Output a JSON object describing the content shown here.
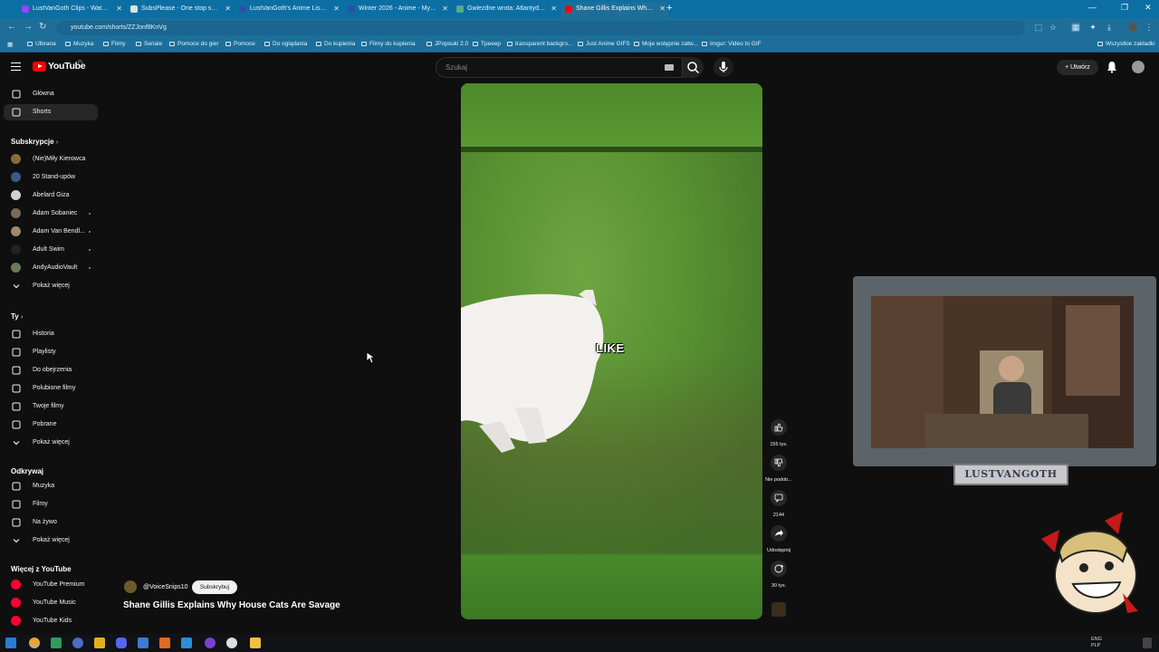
{
  "browser": {
    "tabs": [
      {
        "title": "LustVanGoth Clips - Watch Live",
        "color": "#9146ff"
      },
      {
        "title": "SubsPlease - One stop shop fo",
        "color": "#e0e0e0"
      },
      {
        "title": "LustVanGoth's Anime List - My",
        "color": "#2e51a2"
      },
      {
        "title": "Winter 2026 - Anime - MyAnim",
        "color": "#2e51a2"
      },
      {
        "title": "Gwiezdne wrota: Atlantyda / Sta",
        "color": "#55aa88"
      },
      {
        "title": "Shane Gillis Explains Why H",
        "color": "#ff0000"
      }
    ],
    "url": "youtube.com/shorts/ZZJonf8KnVg",
    "bookmarks": [
      "Ulbrana",
      "Muzyka",
      "Filmy",
      "Seriale",
      "Pomoce do gier",
      "Pomoce",
      "Do oglądania",
      "Do kupienia",
      "Filmy do kupienia",
      "JPopsuki 2.0",
      "Tpeeep",
      "transparent backgro...",
      "Just Anime GIFS",
      "Moje wstępnie zatw...",
      "Imgur: Video to GIF"
    ],
    "all_bookmarks": "Wszystkie zakładki"
  },
  "youtube": {
    "logo_text": "YouTube",
    "logo_country": "PL",
    "search_placeholder": "Szukaj",
    "create_label": "Utwórz"
  },
  "sidebar": {
    "main": [
      {
        "label": "Główna",
        "icon": "home-icon"
      },
      {
        "label": "Shorts",
        "icon": "shorts-icon"
      }
    ],
    "subs_header": "Subskrypcje",
    "subs": [
      {
        "label": "(Nie)Miły Kierowca",
        "color": "#8a6a3a",
        "dot": false
      },
      {
        "label": "20 Stand-upów",
        "color": "#3a5a8a",
        "dot": false
      },
      {
        "label": "Abelard Giza",
        "color": "#d0d0d0",
        "dot": false
      },
      {
        "label": "Adam Sobaniec",
        "color": "#7a6a5a",
        "dot": true
      },
      {
        "label": "Adam Van Bendl...",
        "color": "#a08a6a",
        "dot": true
      },
      {
        "label": "Adult Swim",
        "color": "#222222",
        "dot": true
      },
      {
        "label": "AndyAudioVault",
        "color": "#6a7a5a",
        "dot": true
      }
    ],
    "show_more": "Pokaż więcej",
    "you_header": "Ty",
    "you": [
      {
        "label": "Historia",
        "icon": "history-icon"
      },
      {
        "label": "Playlisty",
        "icon": "playlist-icon"
      },
      {
        "label": "Do obejrzenia",
        "icon": "watch-later-icon"
      },
      {
        "label": "Polubione filmy",
        "icon": "like-icon"
      },
      {
        "label": "Twoje filmy",
        "icon": "your-videos-icon"
      },
      {
        "label": "Pobrane",
        "icon": "download-icon"
      },
      {
        "label": "Pokaż więcej",
        "icon": "chevron-down-icon"
      }
    ],
    "explore_header": "Odkrywaj",
    "explore": [
      {
        "label": "Muzyka",
        "icon": "music-icon"
      },
      {
        "label": "Filmy",
        "icon": "film-icon"
      },
      {
        "label": "Na żywo",
        "icon": "live-icon"
      },
      {
        "label": "Pokaż więcej",
        "icon": "chevron-down-icon"
      }
    ],
    "more_header": "Więcej z YouTube",
    "more": [
      {
        "label": "YouTube Premium"
      },
      {
        "label": "YouTube Music"
      },
      {
        "label": "YouTube Kids"
      }
    ]
  },
  "short": {
    "caption": "LIKE",
    "channel": "@VoiceSnips10",
    "subscribe": "Subskrybuj",
    "title": "Shane Gillis Explains Why House Cats Are Savage",
    "actions": {
      "likes": "155 tys.",
      "dislike": "Nie podob...",
      "comments": "2144",
      "share": "Udostępnij",
      "remix": "30 tys."
    }
  },
  "overlay": {
    "streamer_name": "LUSTVANGOTH"
  },
  "taskbar": {
    "lang1": "ENG",
    "lang2": "PLP"
  }
}
